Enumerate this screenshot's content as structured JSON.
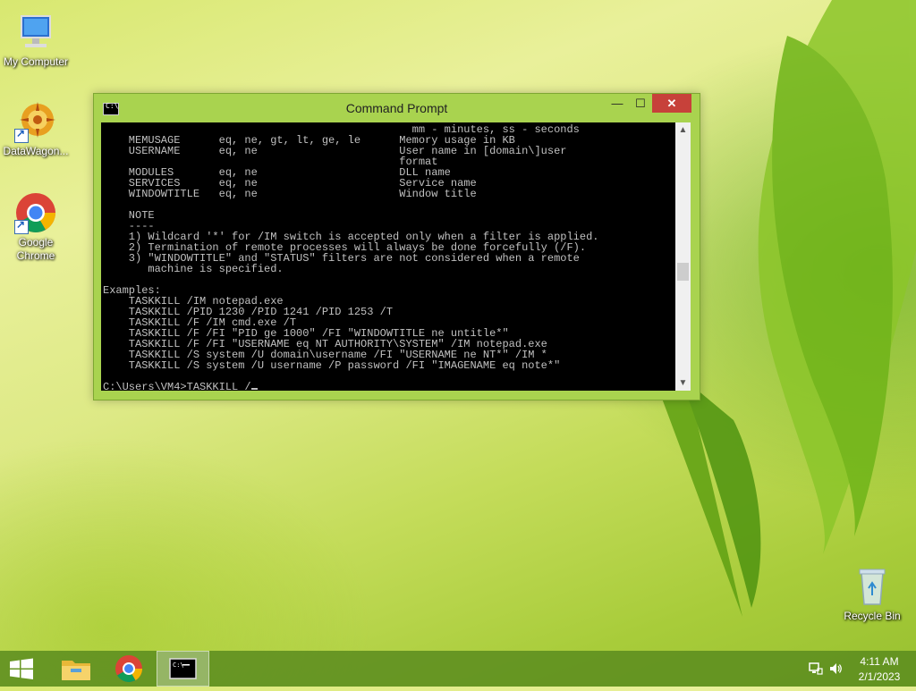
{
  "desktop": {
    "icons": [
      {
        "label": "My Computer"
      },
      {
        "label": "DataWagon..."
      },
      {
        "label": "Google Chrome"
      },
      {
        "label": "Recycle Bin"
      }
    ]
  },
  "window": {
    "title": "Command Prompt",
    "buttons": {
      "minimize": "—",
      "maximize": "☐",
      "close": "✕"
    },
    "console_lines": [
      "                                                mm - minutes, ss - seconds",
      "    MEMUSAGE      eq, ne, gt, lt, ge, le      Memory usage in KB",
      "    USERNAME      eq, ne                      User name in [domain\\]user",
      "                                              format",
      "    MODULES       eq, ne                      DLL name",
      "    SERVICES      eq, ne                      Service name",
      "    WINDOWTITLE   eq, ne                      Window title",
      "",
      "    NOTE",
      "    ----",
      "    1) Wildcard '*' for /IM switch is accepted only when a filter is applied.",
      "    2) Termination of remote processes will always be done forcefully (/F).",
      "    3) \"WINDOWTITLE\" and \"STATUS\" filters are not considered when a remote",
      "       machine is specified.",
      "",
      "Examples:",
      "    TASKKILL /IM notepad.exe",
      "    TASKKILL /PID 1230 /PID 1241 /PID 1253 /T",
      "    TASKKILL /F /IM cmd.exe /T",
      "    TASKKILL /F /FI \"PID ge 1000\" /FI \"WINDOWTITLE ne untitle*\"",
      "    TASKKILL /F /FI \"USERNAME eq NT AUTHORITY\\SYSTEM\" /IM notepad.exe",
      "    TASKKILL /S system /U domain\\username /FI \"USERNAME ne NT*\" /IM *",
      "    TASKKILL /S system /U username /P password /FI \"IMAGENAME eq note*\"",
      ""
    ],
    "prompt": "C:\\Users\\VM4>TASKKILL /"
  },
  "taskbar": {
    "items": [
      {
        "icon": "windows-start-icon"
      },
      {
        "icon": "file-explorer-icon"
      },
      {
        "icon": "chrome-icon"
      },
      {
        "icon": "command-prompt-icon",
        "active": true
      }
    ],
    "clock": {
      "time": "4:11 AM",
      "date": "2/1/2023"
    }
  },
  "colors": {
    "titlebar": "#a9d34f",
    "close": "#c7413a",
    "console_bg": "#000000",
    "console_fg": "#c0c0c0"
  }
}
